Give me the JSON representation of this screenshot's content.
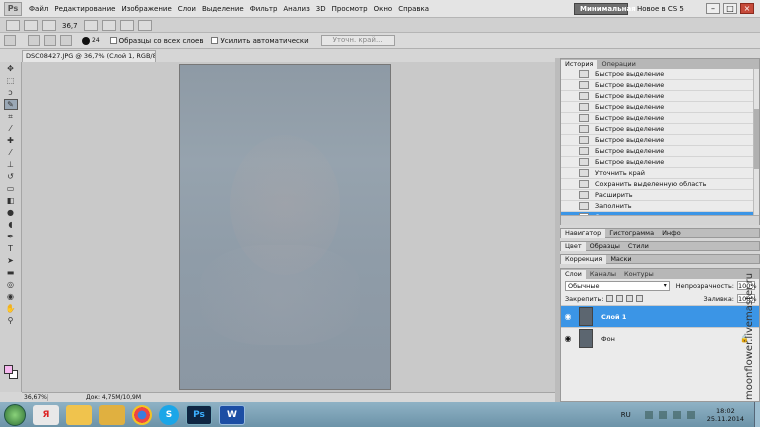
{
  "app": {
    "logo": "Ps",
    "menu": [
      "Файл",
      "Редактирование",
      "Изображение",
      "Слои",
      "Выделение",
      "Фильтр",
      "Анализ",
      "3D",
      "Просмотр",
      "Окно",
      "Справка"
    ],
    "zoom": "36,7",
    "workspace_active": "Минимальная",
    "workspace_other": "Новое в CS 5",
    "window_controls": [
      "–",
      "□",
      "×"
    ]
  },
  "options": {
    "brush_size": "24",
    "sample_all_layers": "Образцы со всех слоев",
    "auto_enhance": "Усилить автоматически",
    "refine_edge": "Уточн. край..."
  },
  "document": {
    "tab_title": "DSC08427.JPG @ 36,7% (Слой 1, RGB/8) *",
    "status_zoom": "36,67%",
    "status_doc": "Док: 4,75M/10,9M"
  },
  "history": {
    "tabs": [
      "История",
      "Операции"
    ],
    "items": [
      {
        "label": "Быстрое выделение",
        "selected": false
      },
      {
        "label": "Быстрое выделение",
        "selected": false
      },
      {
        "label": "Быстрое выделение",
        "selected": false
      },
      {
        "label": "Быстрое выделение",
        "selected": false
      },
      {
        "label": "Быстрое выделение",
        "selected": false
      },
      {
        "label": "Быстрое выделение",
        "selected": false
      },
      {
        "label": "Быстрое выделение",
        "selected": false
      },
      {
        "label": "Быстрое выделение",
        "selected": false
      },
      {
        "label": "Быстрое выделение",
        "selected": false
      },
      {
        "label": "Уточнить край",
        "selected": false
      },
      {
        "label": "Сохранить выделенную область",
        "selected": false
      },
      {
        "label": "Расширить",
        "selected": false
      },
      {
        "label": "Заполнить",
        "selected": false
      },
      {
        "label": "Отменить выделение",
        "selected": true
      }
    ]
  },
  "nav_tabs": [
    "Навигатор",
    "Гистограмма",
    "Инфо"
  ],
  "color_tabs": [
    "Цвет",
    "Образцы",
    "Стили"
  ],
  "adjust_tabs": [
    "Коррекция",
    "Маски"
  ],
  "layers": {
    "tabs": [
      "Слои",
      "Каналы",
      "Контуры"
    ],
    "blend_mode": "Обычные",
    "opacity_label": "Непрозрачность:",
    "opacity_value": "100%",
    "lock_label": "Закрепить:",
    "fill_label": "Заливка:",
    "fill_value": "100%",
    "items": [
      {
        "name": "Слой 1",
        "selected": true,
        "locked": false
      },
      {
        "name": "Фон",
        "selected": false,
        "locked": true
      }
    ]
  },
  "watermark": "moonflower.livemaster.ru",
  "taskbar": {
    "apps": [
      "Я",
      "",
      "",
      "",
      "S",
      "Ps",
      "W"
    ],
    "lang": "RU",
    "time": "18:02",
    "date": "25.11.2014"
  },
  "colors": {
    "selection": "#3b95e6",
    "foreground_swatch": "#f6b8ef",
    "background_swatch": "#ffffff"
  }
}
